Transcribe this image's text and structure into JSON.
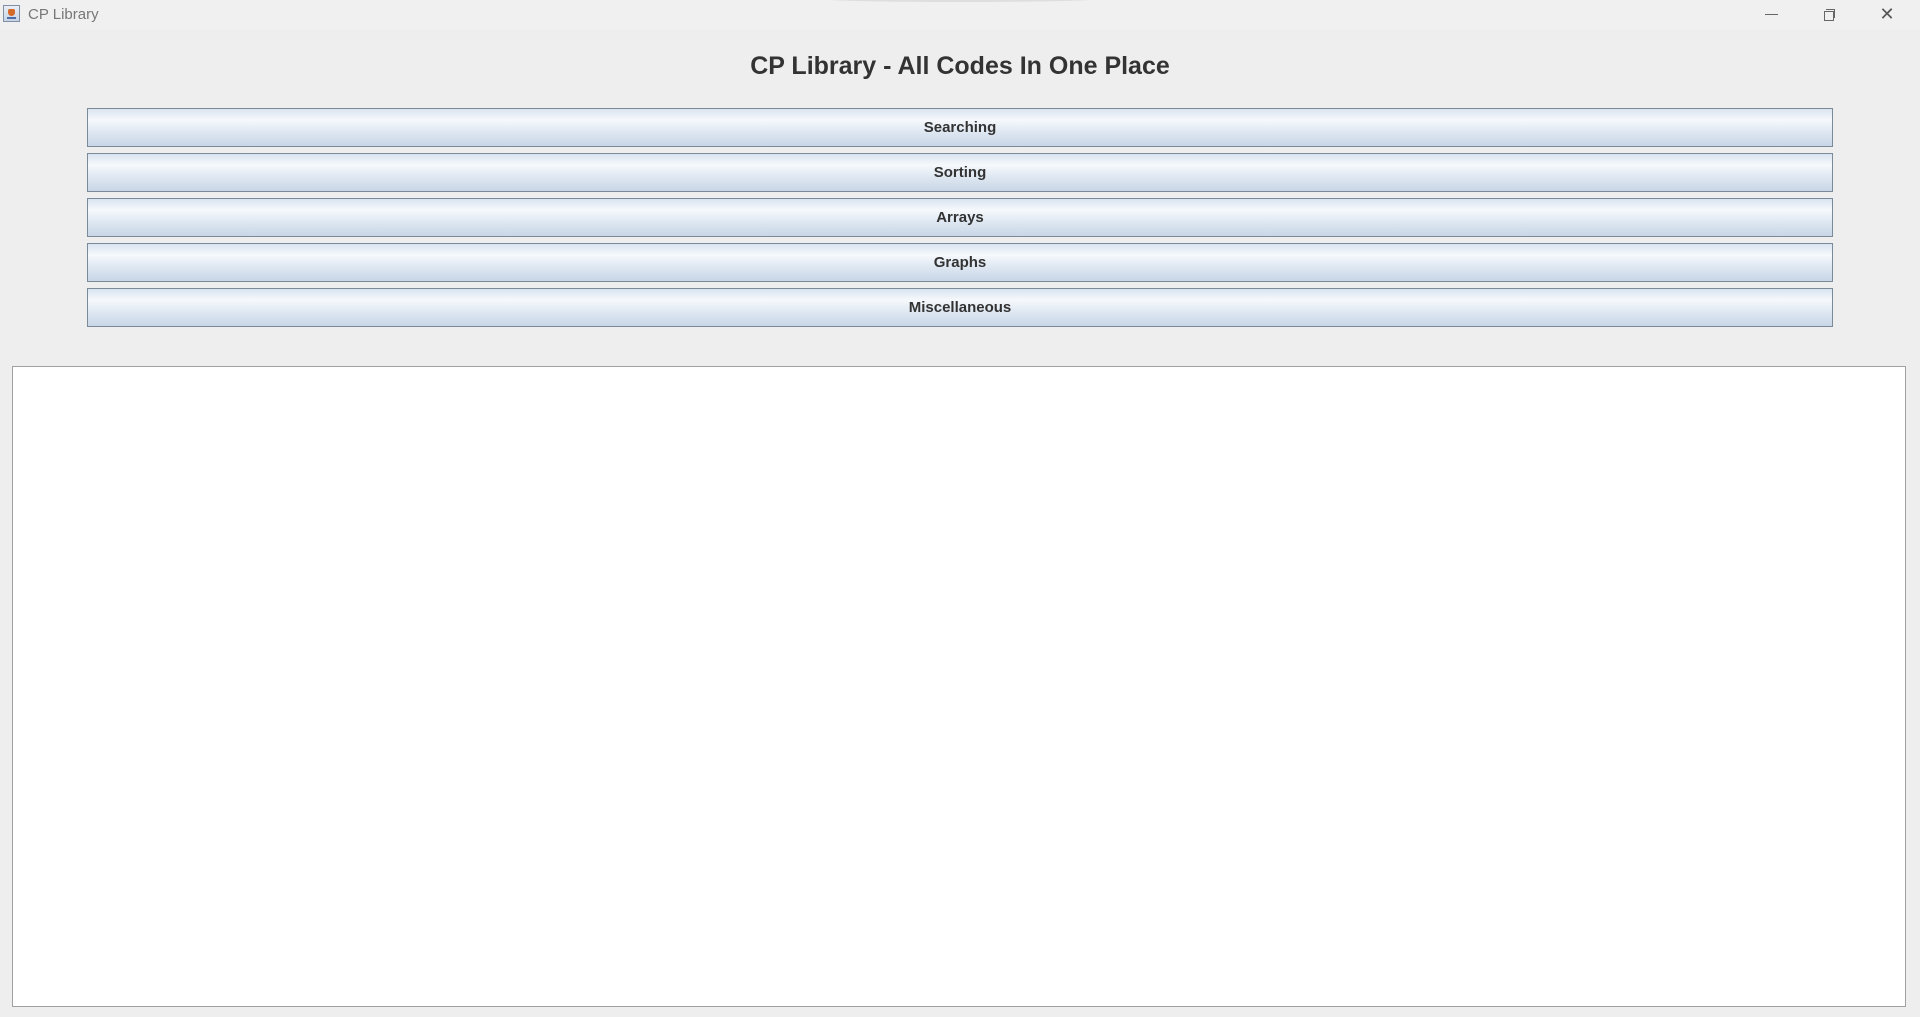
{
  "window": {
    "title": "CP Library"
  },
  "header": {
    "title": "CP Library - All Codes In One Place"
  },
  "menu": {
    "buttons": [
      {
        "label": "Searching"
      },
      {
        "label": "Sorting"
      },
      {
        "label": "Arrays"
      },
      {
        "label": "Graphs"
      },
      {
        "label": "Miscellaneous"
      }
    ]
  },
  "content": {
    "text": ""
  },
  "icons": {
    "app": "java-cup-icon",
    "minimize": "minimize-icon",
    "restore": "restore-icon",
    "close": "close-icon"
  },
  "colors": {
    "background": "#eeeeee",
    "button_gradient_top": "#d9e4f0",
    "button_gradient_bottom": "#c8d6e6",
    "button_border": "#7a8a99",
    "heading_text": "#333333",
    "content_background": "#ffffff"
  }
}
